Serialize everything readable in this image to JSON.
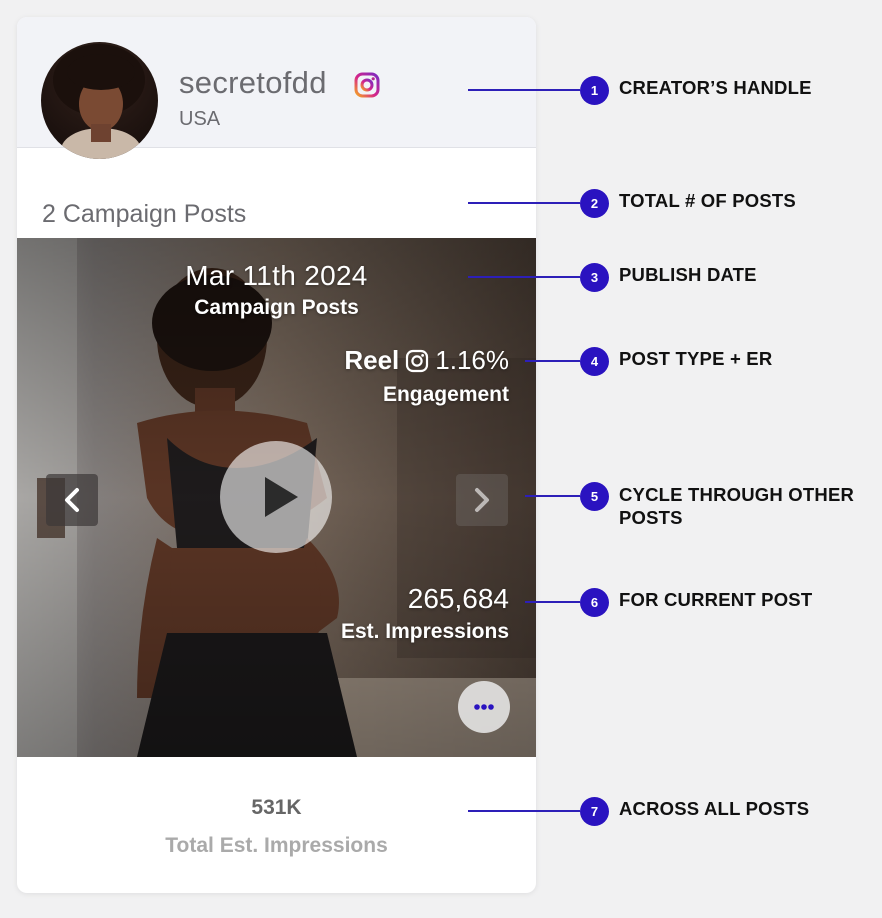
{
  "creator": {
    "handle": "secretofdd",
    "platform_icon": "instagram-icon",
    "country": "USA"
  },
  "posts_summary": {
    "count_label": "2 Campaign Posts"
  },
  "current_post": {
    "publish_date": "Mar 11th 2024",
    "publish_sub": "Campaign Posts",
    "post_type": "Reel",
    "engagement_rate": "1.16%",
    "engagement_label": "Engagement",
    "impressions": "265,684",
    "impressions_label": "Est. Impressions"
  },
  "totals": {
    "value": "531K",
    "label": "Total Est. Impressions"
  },
  "annotations": [
    {
      "num": "1",
      "lines": [
        "CREATOR’S HANDLE"
      ]
    },
    {
      "num": "2",
      "lines": [
        "TOTAL # OF POSTS"
      ]
    },
    {
      "num": "3",
      "lines": [
        "PUBLISH DATE"
      ]
    },
    {
      "num": "4",
      "lines": [
        "POST TYPE + ER"
      ]
    },
    {
      "num": "5",
      "lines": [
        "CYCLE THROUGH OTHER",
        "POSTS"
      ]
    },
    {
      "num": "6",
      "lines": [
        "FOR CURRENT POST"
      ]
    },
    {
      "num": "7",
      "lines": [
        "ACROSS ALL POSTS"
      ]
    }
  ],
  "colors": {
    "accent": "#2a13c0",
    "instagram": "#c13584",
    "text_muted": "#6b6b70"
  }
}
